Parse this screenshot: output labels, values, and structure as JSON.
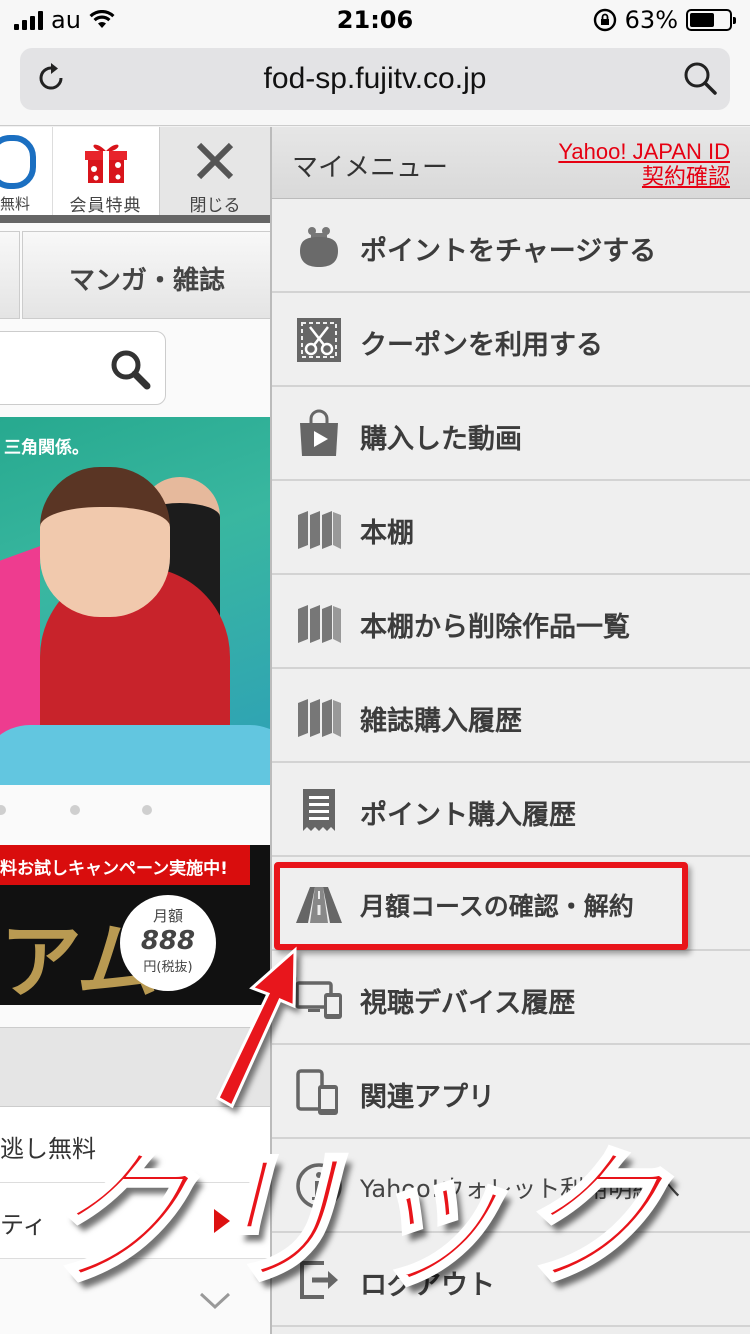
{
  "status_bar": {
    "carrier": "au",
    "time": "21:06",
    "battery": "63%",
    "battery_level": 0.63
  },
  "browser": {
    "url": "fod-sp.fujitv.co.jp"
  },
  "left_page": {
    "free_label": "無料",
    "gift_label": "会員特典",
    "close_label": "閉じる",
    "tab_manga": "マンガ・雑誌",
    "hero_tagline": "三角関係。",
    "banner_strip": "料お試しキャンペーン実施中!",
    "banner_big": "アム",
    "badge_line1": "月額",
    "badge_line2": "888",
    "badge_line3": "円(税抜)",
    "row1": "逃し無料",
    "row2": "ティ"
  },
  "menu": {
    "title": "マイメニュー",
    "yahoo_link_1": "Yahoo! JAPAN ID",
    "yahoo_link_2": "契約確認",
    "items": [
      {
        "label": "ポイントをチャージする",
        "icon": "coin-purse-icon"
      },
      {
        "label": "クーポンを利用する",
        "icon": "coupon-scissors-icon"
      },
      {
        "label": "購入した動画",
        "icon": "shopping-bag-play-icon"
      },
      {
        "label": "本棚",
        "icon": "bookshelf-icon"
      },
      {
        "label": "本棚から削除作品一覧",
        "icon": "bookshelf-icon"
      },
      {
        "label": "雑誌購入履歴",
        "icon": "bookshelf-icon"
      },
      {
        "label": "ポイント購入履歴",
        "icon": "receipt-icon"
      },
      {
        "label": "月額コースの確認・解約",
        "icon": "road-icon"
      },
      {
        "label": "視聴デバイス履歴",
        "icon": "devices-icon"
      },
      {
        "label": "関連アプリ",
        "icon": "phone-tablet-icon"
      },
      {
        "label": "Yahoo!ウォレット利用明細へ",
        "icon": "info-icon"
      },
      {
        "label": "ログアウト",
        "icon": "logout-icon"
      }
    ]
  },
  "annotation": {
    "text": "クリック",
    "color": "#e8141a"
  }
}
